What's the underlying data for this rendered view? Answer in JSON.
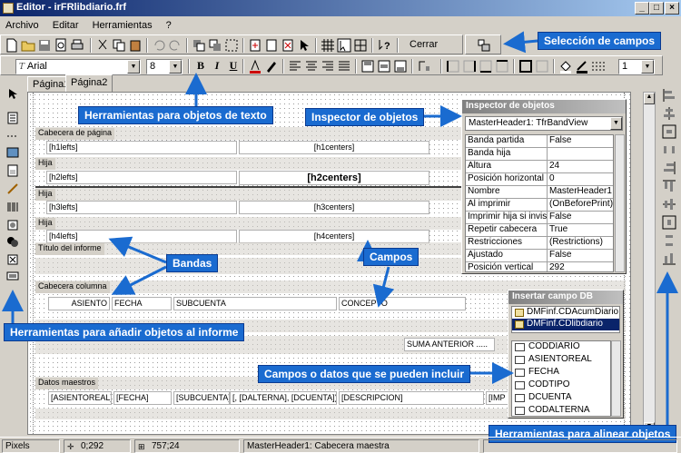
{
  "title": "Editor - irFRlibdiario.frf",
  "menu": [
    "Archivo",
    "Editar",
    "Herramientas",
    "?"
  ],
  "toolbar": {
    "cerrar": "Cerrar",
    "font": "Arial",
    "font_size": "8",
    "size2": "1",
    "bold": "B",
    "italic": "I",
    "underline": "U"
  },
  "tabs": [
    "Página1",
    "Página2"
  ],
  "bands": {
    "cabecera_pagina": "Cabecera de página",
    "hija1": "Hija",
    "hija2": "Hija",
    "hija3": "Hija",
    "titulo": "Título del informe",
    "cabecera_columna": "Cabecera columna",
    "datos_maestros": "Datos maestros"
  },
  "fields": {
    "h1lefts": "[h1lefts]",
    "h1centers": "[h1centers]",
    "h2lefts": "[h2lefts]",
    "h2centers": "[h2centers]",
    "h3lefts": "[h3lefts]",
    "h3centers": "[h3centers]",
    "h4lefts": "[h4lefts]",
    "h4centers": "[h4centers]",
    "asiento": "ASIENTO",
    "fecha": "FECHA",
    "subcuenta": "SUBCUENTA",
    "concepto": "CONCEPTO",
    "suma": "SUMA ANTERIOR .....",
    "d_asiento": "[ASIENTOREAL]",
    "d_fecha": "[FECHA]",
    "d_subcuenta": "[SUBCUENTA])",
    "d_alterna": "[, [DALTERNA], [DCUENTA])",
    "d_desc": "[DESCRIPCION]",
    "d_imp": "[IMP"
  },
  "inspector": {
    "title": "Inspector de objetos",
    "selector": "MasterHeader1: TfrBandView",
    "rows": [
      {
        "k": "Banda partida",
        "v": "False"
      },
      {
        "k": "Banda hija",
        "v": ""
      },
      {
        "k": "Altura",
        "v": "24"
      },
      {
        "k": "Posición horizontal",
        "v": "0"
      },
      {
        "k": "Nombre",
        "v": "MasterHeader1"
      },
      {
        "k": "Al imprimir",
        "v": "(OnBeforePrint)"
      },
      {
        "k": "Imprimir hija si invisibl",
        "v": "False"
      },
      {
        "k": "Repetir cabecera",
        "v": "True"
      },
      {
        "k": "Restricciones",
        "v": "(Restrictions)"
      },
      {
        "k": "Ajustado",
        "v": "False"
      },
      {
        "k": "Posición vertical",
        "v": "292"
      }
    ]
  },
  "insertdb": {
    "title": "Insertar campo DB",
    "sources": [
      "DMFinf.CDAcumDiario",
      "DMFinf.CDlibdiario"
    ],
    "fields": [
      "CODDIARIO",
      "ASIENTOREAL",
      "FECHA",
      "CODTIPO",
      "DCUENTA",
      "CODALTERNA"
    ]
  },
  "callouts": {
    "seleccion": "Selección de campos",
    "herr_texto": "Herramientas para objetos de texto",
    "inspector": "Inspector de objetos",
    "bandas": "Bandas",
    "campos": "Campos",
    "herr_anadir": "Herramientas para añadir objetos al informe",
    "campos_datos": "Campos o datos que se pueden incluir",
    "alinear": "Herramientas para alinear objetos"
  },
  "status": {
    "units": "Pixels",
    "pos": "0;292",
    "size": "757;24",
    "selected": "MasterHeader1: Cabecera maestra"
  },
  "colors": {
    "accent": "#1a6bd0",
    "titlebar": "#0a246a"
  }
}
